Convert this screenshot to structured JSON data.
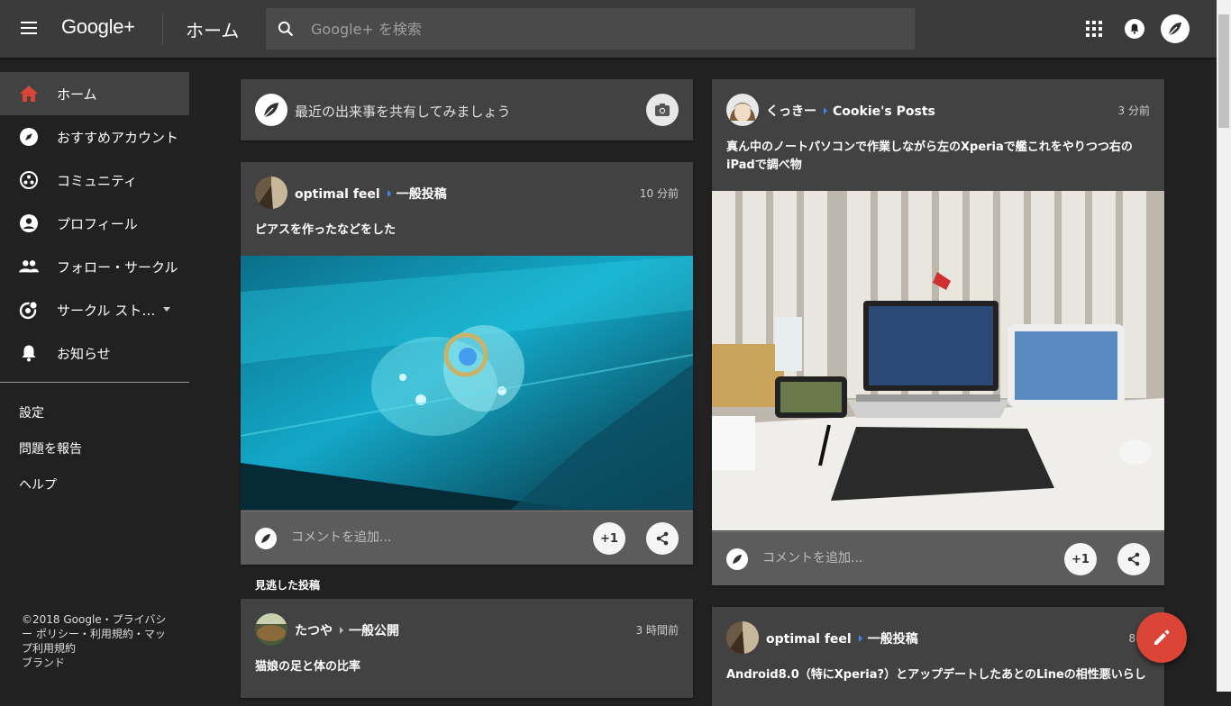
{
  "header": {
    "logo": "Google+",
    "page_title": "ホーム",
    "search_placeholder": "Google+ を検索"
  },
  "sidebar": {
    "items": [
      {
        "label": "ホーム",
        "icon": "home-icon",
        "active": true
      },
      {
        "label": "おすすめアカウント",
        "icon": "compass-icon"
      },
      {
        "label": "コミュニティ",
        "icon": "community-icon"
      },
      {
        "label": "プロフィール",
        "icon": "profile-icon"
      },
      {
        "label": "フォロー・サークル",
        "icon": "people-icon"
      },
      {
        "label": "サークル スト…",
        "icon": "circle-stream-icon",
        "dropdown": true
      },
      {
        "label": "お知らせ",
        "icon": "bell-icon"
      }
    ],
    "links": [
      "設定",
      "問題を報告",
      "ヘルプ"
    ],
    "footer": [
      "©2018 Google・プライバシ",
      "ー ポリシー・利用規約・マッ",
      "プ利用規約",
      "ブランド"
    ]
  },
  "share_box": {
    "placeholder": "最近の出来事を共有してみましょう"
  },
  "posts": [
    {
      "author": "optimal feel",
      "target": "一般投稿",
      "time": "10 分前",
      "text": "ピアスを作ったなどをした",
      "comment_placeholder": "コメントを追加...",
      "plus_one": "+1"
    },
    {
      "author": "くっきー",
      "target": "Cookie's Posts",
      "time": "3 分前",
      "text": "真ん中のノートパソコンで作業しながら左のXperiaで艦これをやりつつ右のiPadで調べ物",
      "comment_placeholder": "コメントを追加...",
      "plus_one": "+1"
    },
    {
      "author": "たつや",
      "target": "一般公開",
      "time": "3 時間前",
      "text": "猫娘の足と体の比率"
    },
    {
      "author": "optimal feel",
      "target": "一般投稿",
      "time": "8 分",
      "text": "Android8.0（特にXperia?）とアップデートしたあとのLineの相性悪いらし"
    }
  ],
  "missed_label": "見逃した投稿",
  "colors": {
    "accent": "#db4437",
    "topbar": "#3b3b3b",
    "card": "#424242",
    "background": "#212121",
    "link_arrow": "#4285f4"
  }
}
